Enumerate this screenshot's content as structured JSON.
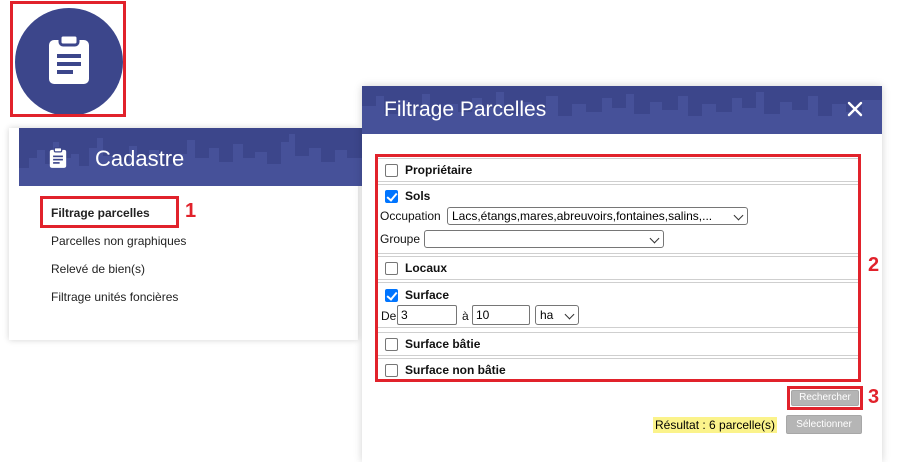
{
  "app_icon": {
    "name": "clipboard-icon"
  },
  "left_panel": {
    "title": "Cadastre",
    "menu": [
      "Filtrage parcelles",
      "Parcelles non graphiques",
      "Relevé de bien(s)",
      "Filtrage unités foncières"
    ]
  },
  "dialog": {
    "title": "Filtrage Parcelles",
    "sections": {
      "proprietaire": {
        "label": "Propriétaire",
        "checked": false
      },
      "sols": {
        "label": "Sols",
        "checked": true,
        "occupation_label": "Occupation",
        "occupation_value": "Lacs,étangs,mares,abreuvoirs,fontaines,salins,...",
        "groupe_label": "Groupe",
        "groupe_value": ""
      },
      "locaux": {
        "label": "Locaux",
        "checked": false
      },
      "surface": {
        "label": "Surface",
        "checked": true,
        "from_label": "De",
        "from_value": "3",
        "to_label": "à",
        "to_value": "10",
        "unit": "ha"
      },
      "surface_batie": {
        "label": "Surface bâtie",
        "checked": false
      },
      "surface_non_batie": {
        "label": "Surface non bâtie",
        "checked": false
      }
    },
    "search_button": "Rechercher",
    "result_text": "Résultat : 6 parcelle(s)",
    "select_button": "Sélectionner"
  },
  "callouts": [
    "1",
    "2",
    "3"
  ],
  "colors": {
    "header": "#3c468b",
    "highlight": "#e1222b",
    "checkbox": "#0075ff",
    "result_bg": "#fbf38b"
  }
}
